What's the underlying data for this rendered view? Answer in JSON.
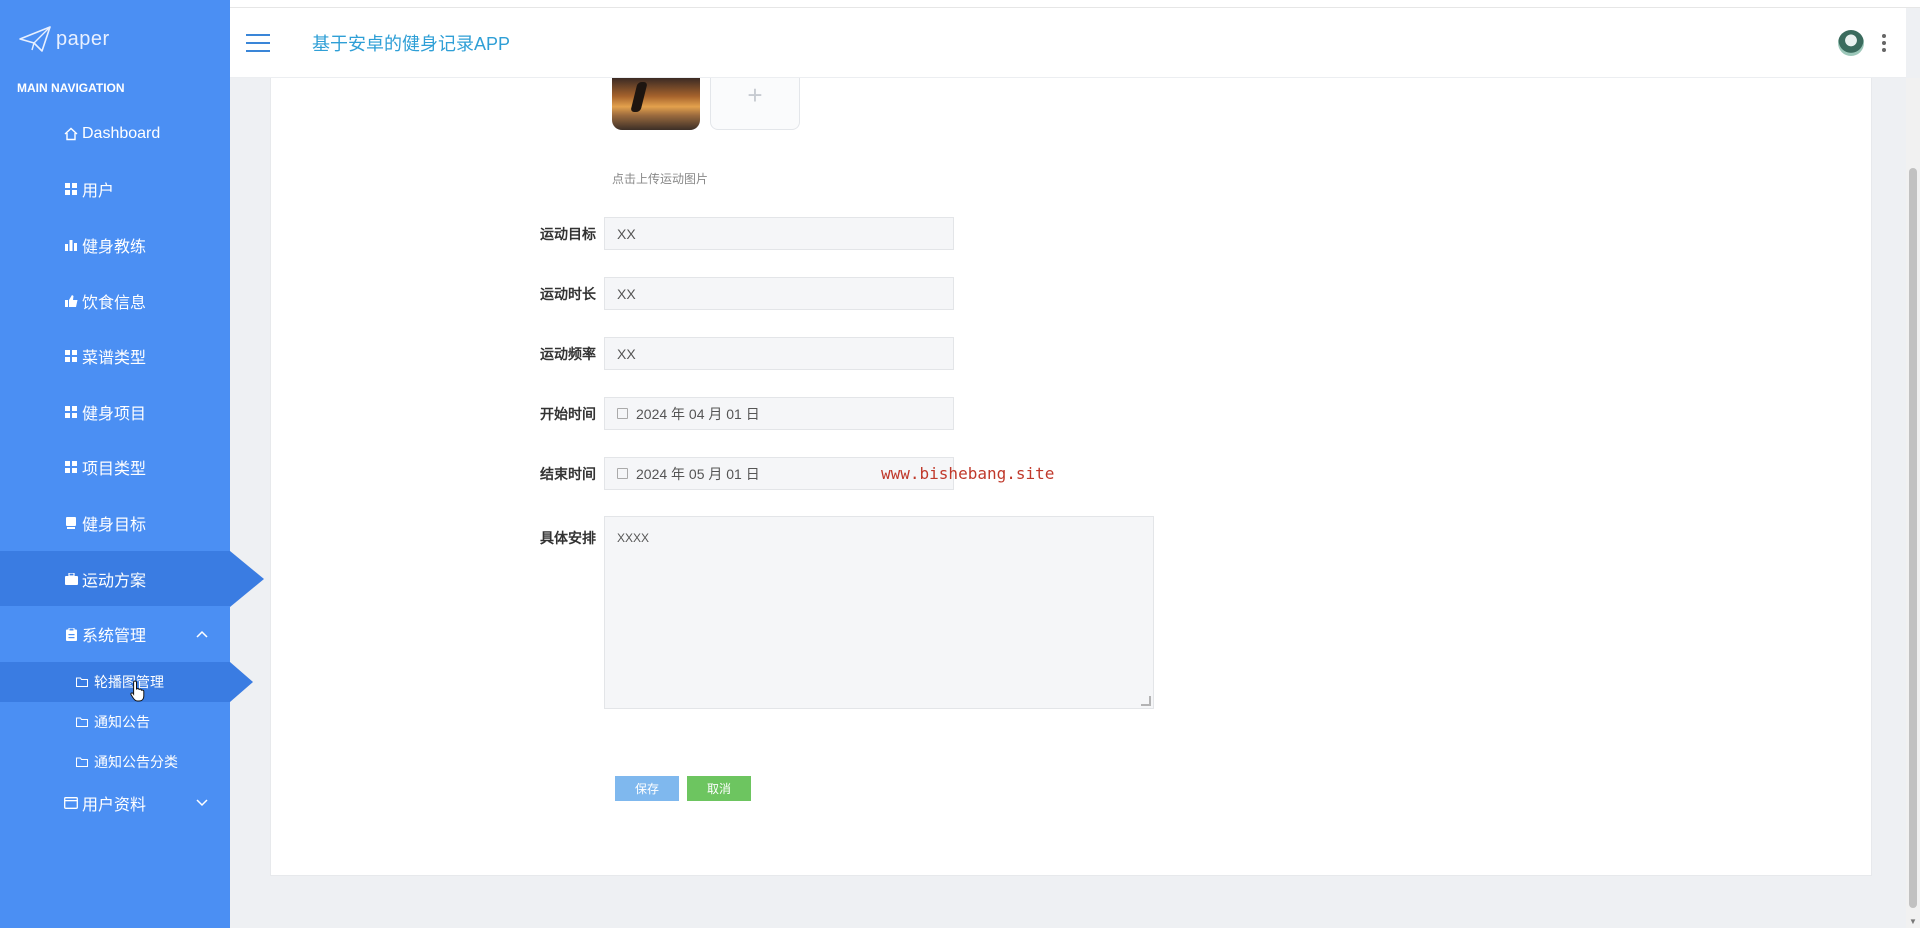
{
  "app": {
    "logo_text": "paper",
    "title": "基于安卓的健身记录APP"
  },
  "sidebar": {
    "header": "MAIN NAVIGATION",
    "items": [
      {
        "label": "Dashboard",
        "icon": "home-icon"
      },
      {
        "label": "用户",
        "icon": "grid-icon"
      },
      {
        "label": "健身教练",
        "icon": "bar-chart-icon"
      },
      {
        "label": "饮食信息",
        "icon": "thumbs-up-icon"
      },
      {
        "label": "菜谱类型",
        "icon": "grid-icon"
      },
      {
        "label": "健身项目",
        "icon": "grid-icon"
      },
      {
        "label": "项目类型",
        "icon": "grid-icon"
      },
      {
        "label": "健身目标",
        "icon": "bookmark-icon"
      },
      {
        "label": "运动方案",
        "icon": "briefcase-icon",
        "active": true
      },
      {
        "label": "系统管理",
        "icon": "clipboard-icon",
        "expanded": true
      }
    ],
    "sub_items": [
      {
        "label": "轮播图管理",
        "icon": "folder-icon",
        "active": true
      },
      {
        "label": "通知公告",
        "icon": "folder-icon"
      },
      {
        "label": "通知公告分类",
        "icon": "folder-icon"
      }
    ],
    "last_item": {
      "label": "用户资料",
      "icon": "id-card-icon"
    }
  },
  "form": {
    "upload_hint": "点击上传运动图片",
    "upload_plus": "+",
    "fields": {
      "goal": {
        "label": "运动目标",
        "value": "XX"
      },
      "duration": {
        "label": "运动时长",
        "value": "XX"
      },
      "frequency": {
        "label": "运动频率",
        "value": "XX"
      },
      "start": {
        "label": "开始时间",
        "value": "2024 年 04 月 01 日"
      },
      "end": {
        "label": "结束时间",
        "value": "2024 年 05 月 01 日"
      },
      "plan": {
        "label": "具体安排",
        "value": "XXXX"
      }
    },
    "save_label": "保存",
    "cancel_label": "取消"
  },
  "watermark": "www.bishebang.site",
  "colors": {
    "sidebar": "#4b8ff3",
    "sidebar_active": "#3a7ce2",
    "title": "#2f9fd6",
    "save": "#7fb8ee",
    "cancel": "#6dc560",
    "watermark": "#c0392b"
  }
}
